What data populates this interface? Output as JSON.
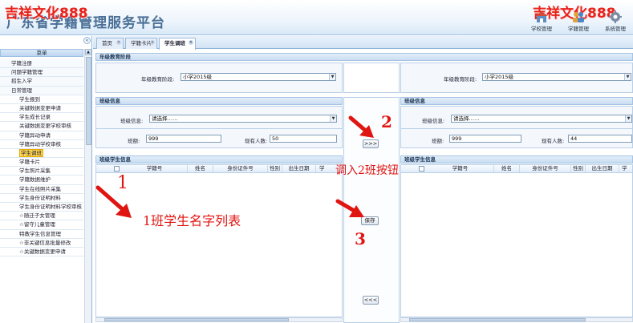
{
  "header": {
    "title": "广东省学籍管理服务平台",
    "watermark": "吉祥文化888",
    "nav": [
      {
        "label": "学校管理",
        "icon": "school-icon"
      },
      {
        "label": "学籍管理",
        "icon": "people-icon"
      },
      {
        "label": "系统管理",
        "icon": "gear-icon"
      }
    ]
  },
  "sidebar": {
    "collapse_glyph": "«",
    "header": "菜单",
    "items": [
      {
        "label": "学籍注册",
        "level": 1
      },
      {
        "label": "问题学籍管理",
        "level": 1
      },
      {
        "label": "招生入学",
        "level": 1
      },
      {
        "label": "日常管理",
        "level": 1
      },
      {
        "label": "学生报到",
        "level": 2
      },
      {
        "label": "关键数据变更申请",
        "level": 2
      },
      {
        "label": "学生成长记录",
        "level": 2
      },
      {
        "label": "关键数据变更学校审核",
        "level": 2
      },
      {
        "label": "学籍异动申请",
        "level": 2
      },
      {
        "label": "学籍异动学校审核",
        "level": 2
      },
      {
        "label": "学生调班",
        "level": 2,
        "selected": true
      },
      {
        "label": "学籍卡片",
        "level": 2
      },
      {
        "label": "学生照片采集",
        "level": 2
      },
      {
        "label": "学籍数据维护",
        "level": 2
      },
      {
        "label": "学生在线照片采集",
        "level": 2
      },
      {
        "label": "学生身份证明材料",
        "level": 2
      },
      {
        "label": "学生身份证明材料学校审核",
        "level": 2
      },
      {
        "label": "☆随迁子女管理",
        "level": 2
      },
      {
        "label": "☆留守儿童管理",
        "level": 2
      },
      {
        "label": "特教学生信息管理",
        "level": 2
      },
      {
        "label": "☆非关键信息批量修改",
        "level": 2
      },
      {
        "label": "☆关键数据变更申请",
        "level": 2
      }
    ]
  },
  "tabs": [
    {
      "label": "首页",
      "active": false
    },
    {
      "label": "学籍卡片",
      "active": false
    },
    {
      "label": "学生调班",
      "active": true
    }
  ],
  "grade_section": {
    "title": "年级教育阶段",
    "left_label": "年级教育阶段:",
    "left_value": "小学2015级",
    "right_label": "年级教育阶段:",
    "right_value": "小学2015级"
  },
  "class_section": {
    "title_left": "班级信息",
    "title_right": "班级信息",
    "left": {
      "class_label": "班级信息:",
      "class_value": "请选择……",
      "size_label": "班额:",
      "size_value": "999",
      "current_label": "现有人数:",
      "current_value": "50"
    },
    "right": {
      "class_label": "班级信息:",
      "class_value": "请选择……",
      "size_label": "班额:",
      "size_value": "999",
      "current_label": "现有人数:",
      "current_value": "44"
    }
  },
  "student_section": {
    "title_left": "班级学生信息",
    "title_right": "班级学生信息",
    "columns": [
      "学籍号",
      "姓名",
      "身份证件号",
      "性别",
      "出生日期",
      "学"
    ]
  },
  "buttons": {
    "move_right": ">>>",
    "save": "保存",
    "move_left": "<<<"
  },
  "annotations": {
    "n1": "1",
    "n2": "2",
    "n3": "3",
    "list_note": "1班学生名字列表",
    "button_note": "调入2班按钮",
    "color": "#e01410"
  }
}
